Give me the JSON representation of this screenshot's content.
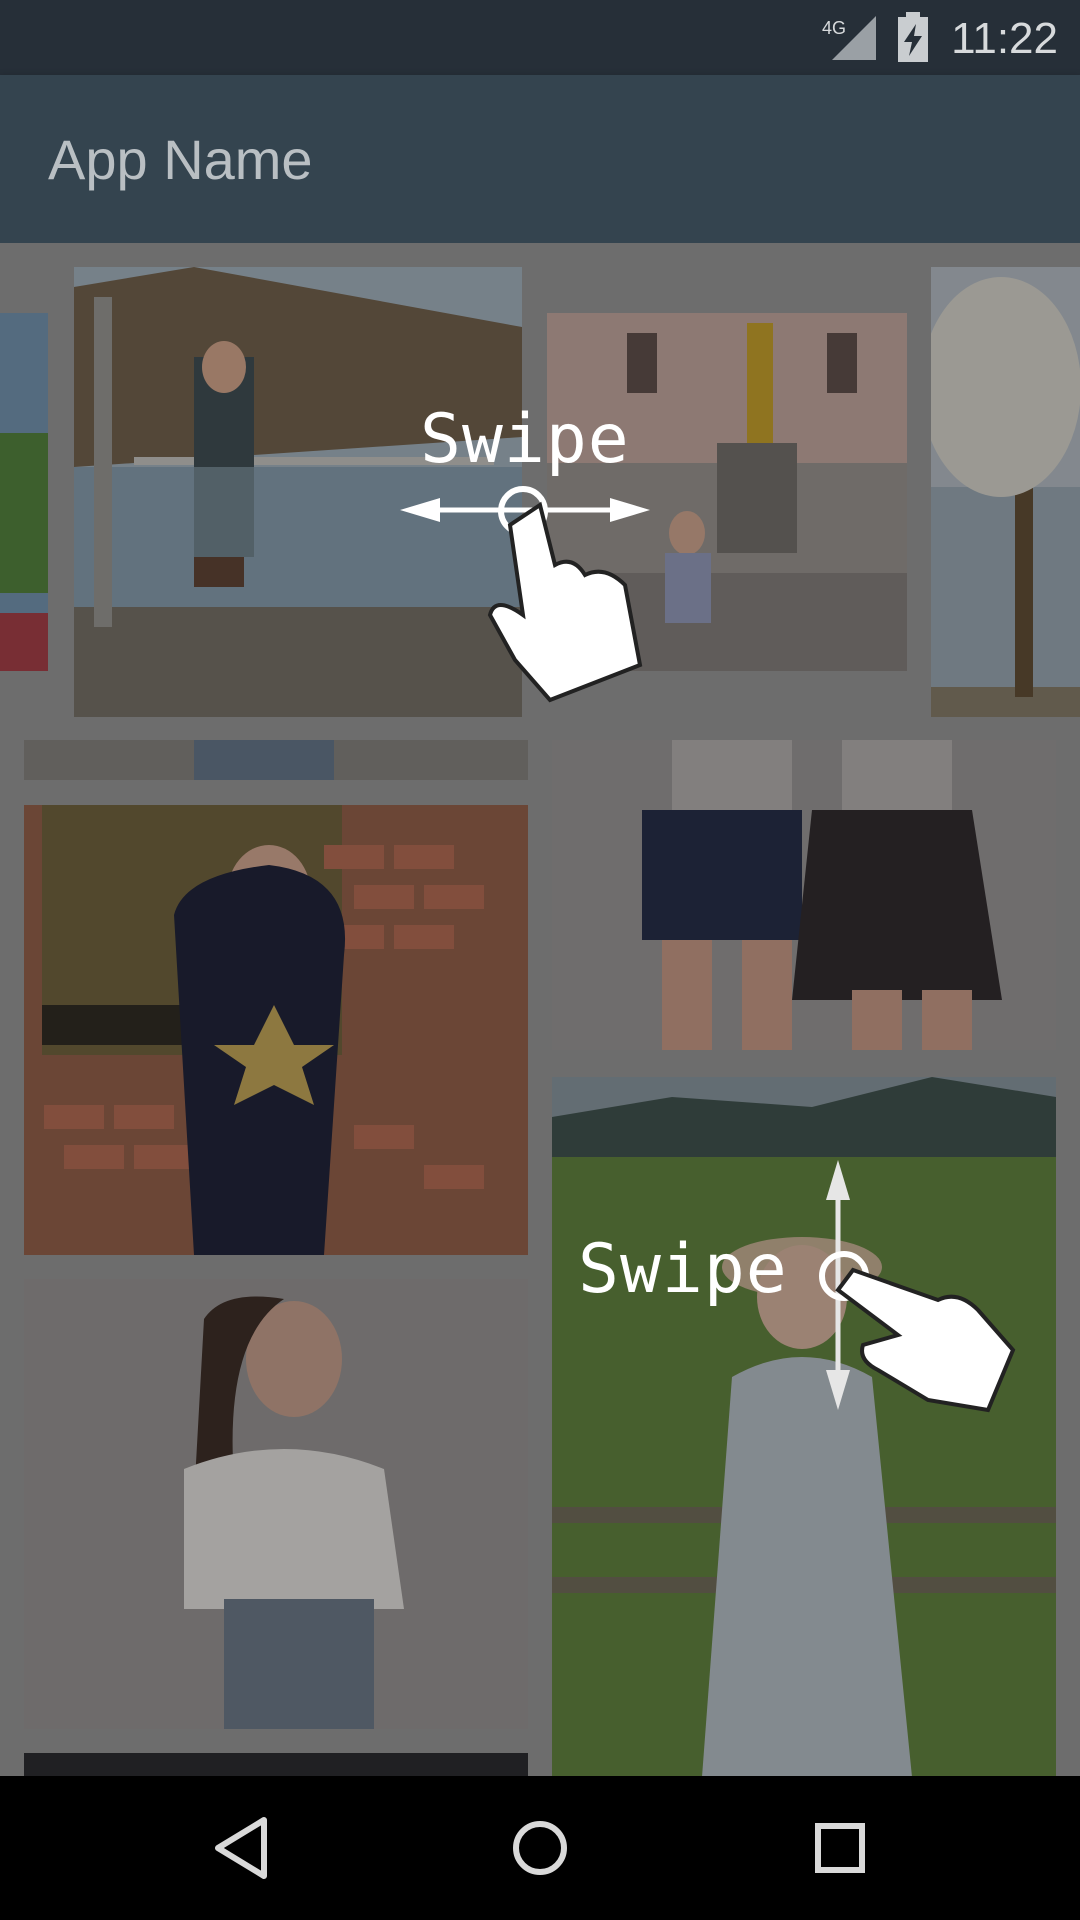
{
  "status_bar": {
    "network": "4G",
    "time": "11:22"
  },
  "app_bar": {
    "title": "App Name"
  },
  "hints": {
    "horizontal": "Swipe",
    "vertical": "Swipe"
  },
  "icons": {
    "back": "back-triangle-icon",
    "home": "home-circle-icon",
    "recents": "recents-square-icon",
    "hand": "pointing-hand-icon"
  },
  "colors": {
    "status_bar": "#262f38",
    "app_bar": "#34444f",
    "nav_bar": "#000000"
  }
}
